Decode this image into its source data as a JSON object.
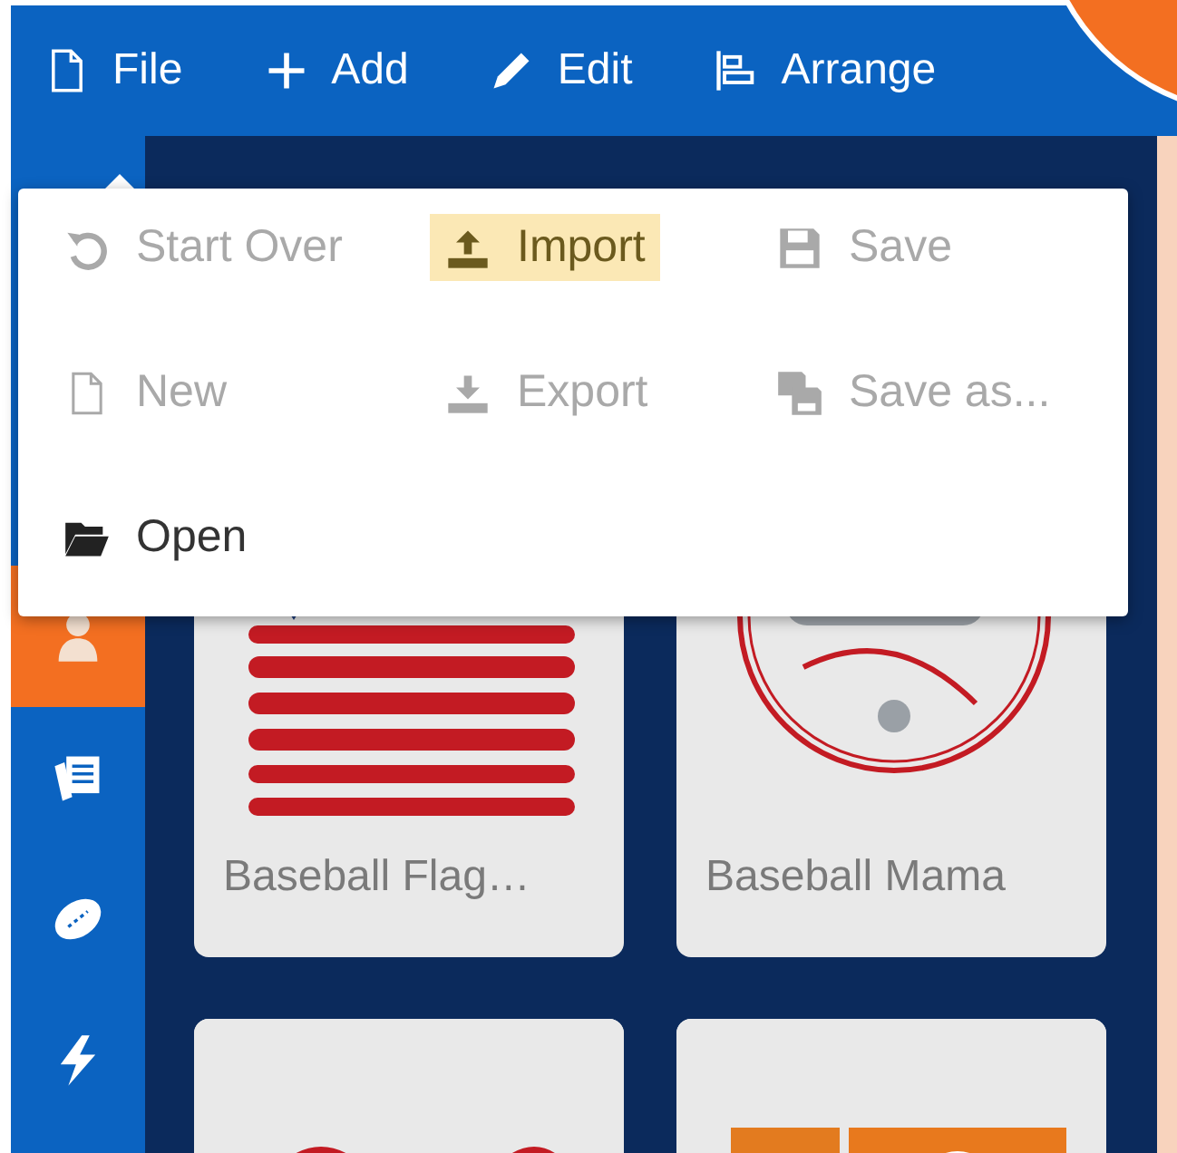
{
  "toolbar": [
    {
      "label": "File",
      "kind": "file"
    },
    {
      "label": "Add",
      "kind": "plus"
    },
    {
      "label": "Edit",
      "kind": "pencil"
    },
    {
      "label": "Arrange",
      "kind": "align"
    }
  ],
  "sidebar": {
    "items": [
      {
        "kind": "figure",
        "selected": true
      },
      {
        "kind": "cards",
        "selected": false
      },
      {
        "kind": "ball",
        "selected": false
      },
      {
        "kind": "bolt",
        "selected": false
      }
    ]
  },
  "file_menu": {
    "items": [
      {
        "label": "Start Over",
        "kind": "undo",
        "disabled": true,
        "selected": false
      },
      {
        "label": "Import",
        "kind": "upload",
        "disabled": false,
        "selected": true
      },
      {
        "label": "Save",
        "kind": "save",
        "disabled": true,
        "selected": false
      },
      {
        "label": "New",
        "kind": "file",
        "disabled": true,
        "selected": false
      },
      {
        "label": "Export",
        "kind": "download",
        "disabled": true,
        "selected": false
      },
      {
        "label": "Save as...",
        "kind": "saveas",
        "disabled": true,
        "selected": false
      },
      {
        "label": "Open",
        "kind": "folder",
        "disabled": false,
        "selected": false
      }
    ]
  },
  "templates": [
    {
      "title": "Baseball Flag…",
      "kind": "picture"
    },
    {
      "title": "Baseball Mama",
      "kind": "picture"
    },
    {
      "kind": "picture"
    },
    {
      "kind": "picture"
    }
  ]
}
